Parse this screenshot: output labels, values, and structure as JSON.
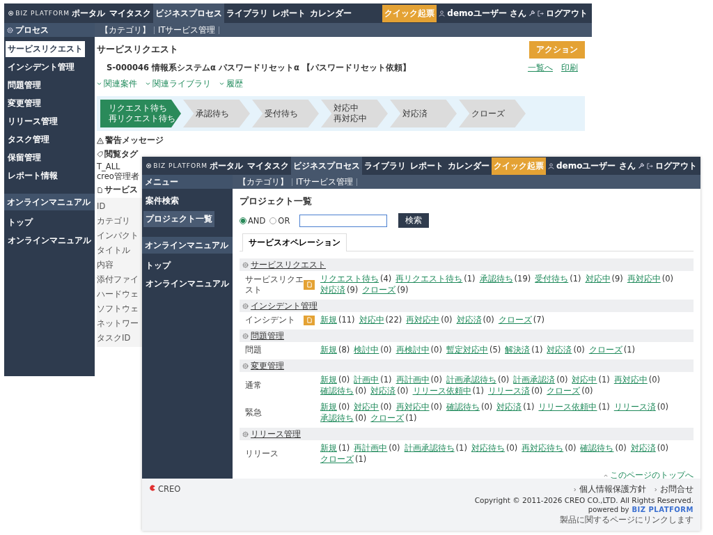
{
  "back_window": {
    "logo": "BIZ PLATFORM",
    "nav": [
      {
        "label": "ポータル",
        "selected": false
      },
      {
        "label": "マイタスク",
        "selected": false
      },
      {
        "label": "ビジネスプロセス",
        "selected": true
      },
      {
        "label": "ライブラリ",
        "selected": false
      },
      {
        "label": "レポート",
        "selected": false
      },
      {
        "label": "カレンダー",
        "selected": false
      }
    ],
    "quick_button": "クイック起票",
    "user": "demoユーザー さん",
    "logout": "ログアウト",
    "sidebar": {
      "header": "プロセス",
      "items": [
        {
          "label": "サービスリクエスト",
          "selected": true
        },
        {
          "label": "インシデント管理",
          "selected": false
        },
        {
          "label": "問題管理",
          "selected": false
        },
        {
          "label": "変更管理",
          "selected": false
        },
        {
          "label": "リリース管理",
          "selected": false
        },
        {
          "label": "タスク管理",
          "selected": false
        },
        {
          "label": "保留管理",
          "selected": false
        },
        {
          "label": "レポート情報",
          "selected": false
        }
      ],
      "manual_header": "オンラインマニュアル",
      "manual_items": [
        "トップ",
        "オンラインマニュアル"
      ]
    },
    "breadcrumb": [
      "【カテゴリ】",
      "ITサービス管理"
    ],
    "title": "サービスリクエスト",
    "action_button": "アクション",
    "record": "S-000046 情報系システムα パスワードリセットα 【パスワードリセット依頼】",
    "record_links": [
      "一覧へ",
      "印刷"
    ],
    "toggles": [
      "関連案件",
      "関連ライブラリ",
      "履歴"
    ],
    "steps": [
      {
        "lines": [
          "リクエスト待ち",
          "再リクエスト待ち"
        ],
        "selected": true
      },
      {
        "lines": [
          "承認待ち"
        ],
        "selected": false
      },
      {
        "lines": [
          "受付待ち"
        ],
        "selected": false
      },
      {
        "lines": [
          "対応中",
          "再対応中"
        ],
        "selected": false
      },
      {
        "lines": [
          "対応済"
        ],
        "selected": false
      },
      {
        "lines": [
          "クローズ"
        ],
        "selected": false
      }
    ],
    "warning": "警告メッセージ",
    "tags_heading": "閲覧タグ",
    "tags": [
      "T_ALL",
      "creo管理者"
    ],
    "detail_heading": "サービス",
    "fields": [
      "ID",
      "カテゴリ",
      "インパクト",
      "タイトル",
      "内容",
      "添付ファイ",
      "ハードウェ",
      "ソフトウェ",
      "ネットワー",
      "タスクID"
    ]
  },
  "front_window": {
    "logo": "BIZ PLATFORM",
    "nav": [
      {
        "label": "ポータル",
        "selected": false
      },
      {
        "label": "マイタスク",
        "selected": false
      },
      {
        "label": "ビジネスプロセス",
        "selected": true
      },
      {
        "label": "ライブラリ",
        "selected": false
      },
      {
        "label": "レポート",
        "selected": false
      },
      {
        "label": "カレンダー",
        "selected": false
      }
    ],
    "quick_button": "クイック起票",
    "user": "demoユーザー さん",
    "logout": "ログアウト",
    "sidebar": {
      "header": "メニュー",
      "items": [
        {
          "label": "案件検索",
          "selected": false
        },
        {
          "label": "プロジェクト一覧",
          "selected": true
        }
      ],
      "manual_header": "オンラインマニュアル",
      "manual_items": [
        "トップ",
        "オンラインマニュアル"
      ]
    },
    "breadcrumb": [
      "【カテゴリ】",
      "ITサービス管理"
    ],
    "title": "プロジェクト一覧",
    "search": {
      "options": [
        {
          "label": "AND",
          "selected": true
        },
        {
          "label": "OR",
          "selected": false
        }
      ],
      "button": "検索"
    },
    "tabs": [
      {
        "label": "サービスオペレーション",
        "selected": true
      }
    ],
    "sections": [
      {
        "title": "サービスリクエスト",
        "rows": [
          {
            "label": "サービスリクエスト",
            "quick_add": true,
            "items": [
              {
                "label": "リクエスト待ち",
                "count": "(4)"
              },
              {
                "label": "再リクエスト待ち",
                "count": "(1)"
              },
              {
                "label": "承認待ち",
                "count": "(19)"
              },
              {
                "label": "受付待ち",
                "count": "(1)"
              },
              {
                "label": "対応中",
                "count": "(9)"
              },
              {
                "label": "再対応中",
                "count": "(0)"
              },
              {
                "label": "対応済",
                "count": "(9)"
              },
              {
                "label": "クローズ",
                "count": "(9)"
              }
            ]
          }
        ]
      },
      {
        "title": "インシデント管理",
        "rows": [
          {
            "label": "インシデント",
            "quick_add": true,
            "items": [
              {
                "label": "新規",
                "count": "(11)"
              },
              {
                "label": "対応中",
                "count": "(22)"
              },
              {
                "label": "再対応中",
                "count": "(0)"
              },
              {
                "label": "対応済",
                "count": "(0)"
              },
              {
                "label": "クローズ",
                "count": "(7)"
              }
            ]
          }
        ]
      },
      {
        "title": "問題管理",
        "rows": [
          {
            "label": "問題",
            "quick_add": false,
            "items": [
              {
                "label": "新規",
                "count": "(8)"
              },
              {
                "label": "検討中",
                "count": "(0)"
              },
              {
                "label": "再検討中",
                "count": "(0)"
              },
              {
                "label": "暫定対応中",
                "count": "(5)"
              },
              {
                "label": "解決済",
                "count": "(1)"
              },
              {
                "label": "対応済",
                "count": "(0)"
              },
              {
                "label": "クローズ",
                "count": "(1)"
              }
            ]
          }
        ]
      },
      {
        "title": "変更管理",
        "rows": [
          {
            "label": "通常",
            "quick_add": false,
            "items": [
              {
                "label": "新規",
                "count": "(0)"
              },
              {
                "label": "計画中",
                "count": "(1)"
              },
              {
                "label": "再計画中",
                "count": "(0)"
              },
              {
                "label": "計画承認待ち",
                "count": "(0)"
              },
              {
                "label": "計画承認済",
                "count": "(0)"
              },
              {
                "label": "対応中",
                "count": "(1)"
              },
              {
                "label": "再対応中",
                "count": "(0)"
              },
              {
                "label": "確認待ち",
                "count": "(0)"
              },
              {
                "label": "対応済",
                "count": "(0)"
              },
              {
                "label": "リリース依頼中",
                "count": "(1)"
              },
              {
                "label": "リリース済",
                "count": "(0)"
              },
              {
                "label": "クローズ",
                "count": "(0)"
              }
            ]
          },
          {
            "label": "緊急",
            "quick_add": false,
            "items": [
              {
                "label": "新規",
                "count": "(0)"
              },
              {
                "label": "対応中",
                "count": "(0)"
              },
              {
                "label": "再対応中",
                "count": "(0)"
              },
              {
                "label": "確認待ち",
                "count": "(0)"
              },
              {
                "label": "対応済",
                "count": "(1)"
              },
              {
                "label": "リリース依頼中",
                "count": "(1)"
              },
              {
                "label": "リリース済",
                "count": "(0)"
              },
              {
                "label": "承認待ち",
                "count": "(0)"
              },
              {
                "label": "クローズ",
                "count": "(1)"
              }
            ]
          }
        ]
      },
      {
        "title": "リリース管理",
        "rows": [
          {
            "label": "リリース",
            "quick_add": false,
            "items": [
              {
                "label": "新規",
                "count": "(1)"
              },
              {
                "label": "再計画中",
                "count": "(0)"
              },
              {
                "label": "計画承認待ち",
                "count": "(1)"
              },
              {
                "label": "対応待ち",
                "count": "(0)"
              },
              {
                "label": "再対応待ち",
                "count": "(0)"
              },
              {
                "label": "確認待ち",
                "count": "(0)"
              },
              {
                "label": "対応済",
                "count": "(0)"
              },
              {
                "label": "クローズ",
                "count": "(1)"
              }
            ]
          }
        ]
      }
    ],
    "page_top": "このページのトップへ",
    "footer": {
      "logo": "CREO",
      "links": [
        "個人情報保護方針",
        "お問合せ"
      ],
      "copyright": "Copyright © 2011-2026 CREO CO.,LTD. All Rights Reserved.",
      "powered": "powered by",
      "powered_logo": "BIZ PLATFORM",
      "note": "製品に関するページにリンクします"
    }
  }
}
